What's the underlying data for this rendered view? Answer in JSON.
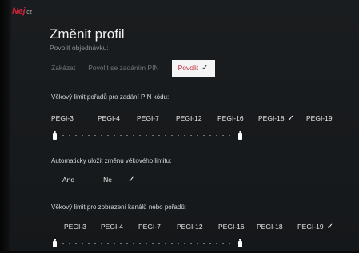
{
  "logo": {
    "main": "Nej",
    "suffix": ".cz"
  },
  "title": "Změnit profil",
  "subtitle": "Povolit objednávku:",
  "order_options": [
    {
      "label": "Zakázat",
      "selected": false
    },
    {
      "label": "Povolit se zadáním PIN",
      "selected": false
    },
    {
      "label": "Povolit",
      "selected": true
    }
  ],
  "check_glyph": "✓",
  "pin_age_limit": {
    "label": "Věkový limit pořadů pro zadání PIN kódu:",
    "options": [
      "PEGI-3",
      "PEGI-4",
      "PEGI-7",
      "PEGI-12",
      "PEGI-16",
      "PEGI-18",
      "PEGI-19"
    ],
    "selected": "PEGI-18"
  },
  "auto_save": {
    "label": "Automaticky uložit změnu věkového limitu:",
    "options": [
      "Ano",
      "Ne"
    ],
    "selected": "Ne"
  },
  "display_age_limit": {
    "label": "Věkový limit pro zobrazení kanálů nebo pořadů:",
    "options": [
      "PEGI-3",
      "PEGI-4",
      "PEGI-7",
      "PEGI-12",
      "PEGI-16",
      "PEGI-18",
      "PEGI-19"
    ],
    "selected": "PEGI-19"
  },
  "colors": {
    "accent": "#b82a36",
    "background": "#181b1d",
    "muted": "#6f7478"
  },
  "icons": {
    "slider_handle": "person-icon"
  }
}
